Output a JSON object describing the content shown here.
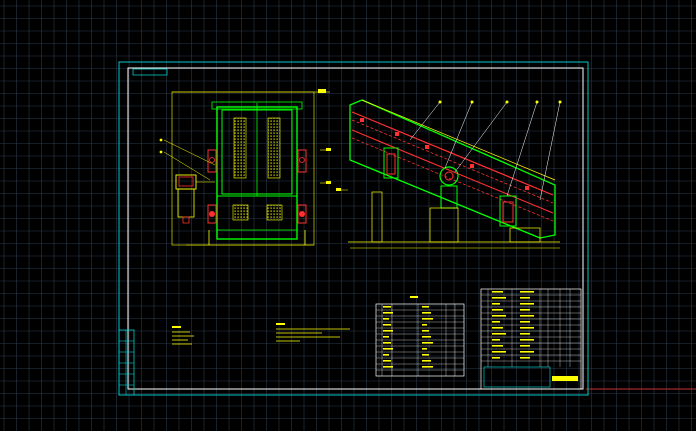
{
  "canvas": {
    "background": "#000000",
    "grid_color": "#2a3a48",
    "frame_color": "#00c8c8",
    "primary_color": "#ffff00",
    "secondary_color": "#00ff00",
    "accent_color": "#ff0000",
    "line_color": "#ffffff",
    "axis_line_color": "#c83030"
  },
  "drawing": {
    "views": [
      "front-view",
      "side-view",
      "notes",
      "parts-table",
      "title-block"
    ]
  }
}
